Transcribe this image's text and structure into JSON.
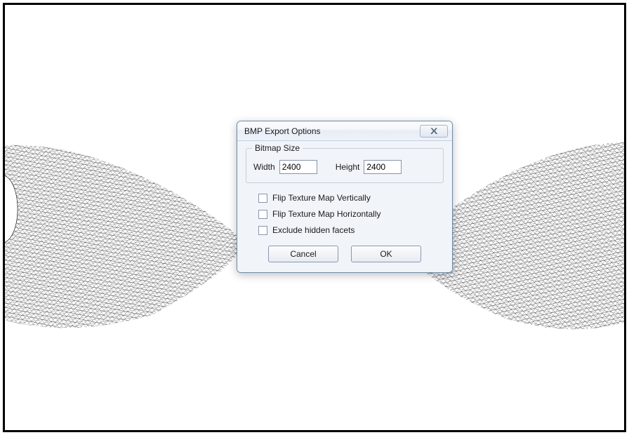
{
  "dialog": {
    "title": "BMP Export Options",
    "fieldset_legend": "Bitmap Size",
    "width_label": "Width",
    "width_value": "2400",
    "height_label": "Height",
    "height_value": "2400",
    "checkbox_flip_v": "Flip Texture Map Vertically",
    "checkbox_flip_h": "Flip Texture Map Horizontally",
    "checkbox_exclude": "Exclude hidden facets",
    "cancel_label": "Cancel",
    "ok_label": "OK"
  }
}
